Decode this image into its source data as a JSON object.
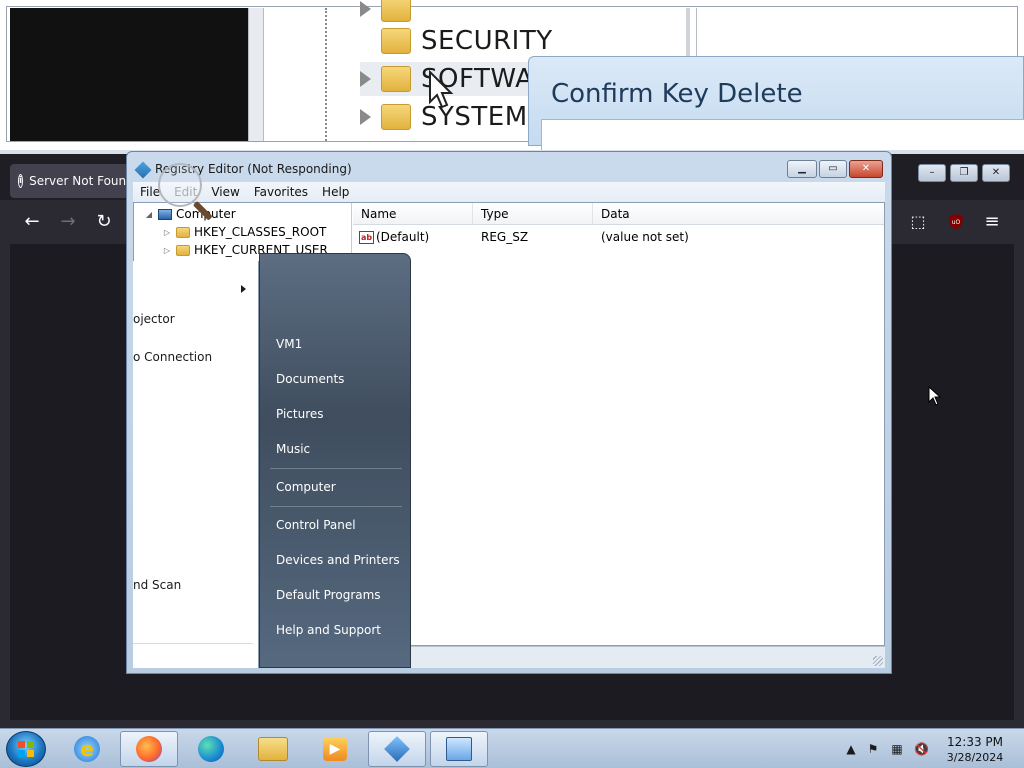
{
  "background_zoom": {
    "tree_items": [
      "SECURITY",
      "SOFTWARE",
      "SYSTEM"
    ],
    "confirm_title": "Confirm Key Delete"
  },
  "browser": {
    "tab_title": "Server Not Found",
    "nav_icons": [
      "back-arrow-icon",
      "forward-arrow-icon",
      "reload-icon",
      "extensions-icon",
      "ublock-icon",
      "menu-icon"
    ]
  },
  "regedit": {
    "title": "Registry Editor (Not Responding)",
    "menu": [
      "File",
      "Edit",
      "View",
      "Favorites",
      "Help"
    ],
    "tree": {
      "root": "Computer",
      "children": [
        "HKEY_CLASSES_ROOT",
        "HKEY_CURRENT_USER"
      ]
    },
    "columns": [
      "Name",
      "Type",
      "Data"
    ],
    "rows": [
      {
        "name": "(Default)",
        "type": "REG_SZ",
        "data": "(value not set)"
      }
    ]
  },
  "start_menu": {
    "left_items": [
      "ojector",
      "o Connection",
      "nd Scan"
    ],
    "right_items": [
      "VM1",
      "Documents",
      "Pictures",
      "Music",
      "Computer",
      "Control Panel",
      "Devices and Printers",
      "Default Programs",
      "Help and Support"
    ]
  },
  "taskbar": {
    "pinned": [
      "internet-explorer-icon",
      "firefox-icon",
      "edge-icon",
      "file-explorer-icon",
      "media-player-icon",
      "regedit-icon",
      "search-magnifier-icon"
    ],
    "clock_time": "12:33 PM",
    "clock_date": "3/28/2024"
  }
}
